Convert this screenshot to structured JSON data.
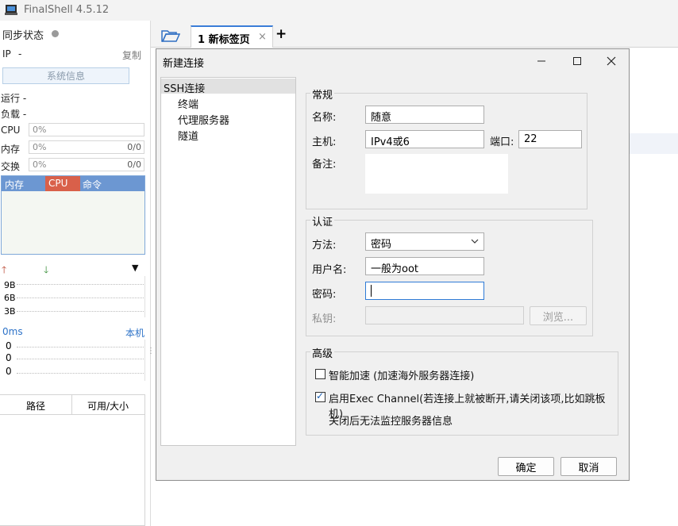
{
  "app": {
    "title": "FinalShell 4.5.12"
  },
  "left_panel": {
    "sync_label": "同步状态",
    "ip_label": "IP",
    "ip_value": "-",
    "copy_label": "复制",
    "sysinfo_button": "系统信息",
    "uptime_label": "运行 -",
    "load_label": "负载 -",
    "cpu": {
      "label": "CPU",
      "value": "0%"
    },
    "mem": {
      "label": "内存",
      "value": "0%",
      "right": "0/0"
    },
    "swap": {
      "label": "交换",
      "value": "0%",
      "right": "0/0"
    },
    "proc_headers": [
      "内存",
      "CPU",
      "命令"
    ],
    "net_ticks": [
      "9B",
      "6B",
      "3B"
    ],
    "ping": {
      "label": "0ms",
      "target": "本机",
      "ticks": [
        "0",
        "0",
        "0"
      ]
    },
    "disk_headers": [
      "路径",
      "可用/大小"
    ]
  },
  "tabs": [
    {
      "label": "1 新标签页"
    }
  ],
  "dialog": {
    "title": "新建连接",
    "nav": [
      "SSH连接",
      "终端",
      "代理服务器",
      "隧道"
    ],
    "general": {
      "title": "常规",
      "name_label": "名称:",
      "name_value": "随意",
      "host_label": "主机:",
      "host_value": "IPv4或6",
      "port_label": "端口:",
      "port_value": "22",
      "note_label": "备注:"
    },
    "auth": {
      "title": "认证",
      "method_label": "方法:",
      "method_value": "密码",
      "user_label": "用户名:",
      "user_value": "一般为oot",
      "password_label": "密码:",
      "password_value": "",
      "key_label": "私钥:",
      "browse_button": "浏览..."
    },
    "advanced": {
      "title": "高级",
      "smart_accel": "智能加速 (加速海外服务器连接)",
      "exec_channel": "启用Exec Channel(若连接上就被断开,请关闭该项,比如跳板机)",
      "exec_note": "关闭后无法监控服务器信息"
    },
    "ok_button": "确定",
    "cancel_button": "取消"
  },
  "colors": {
    "accent": "#3b7dd8",
    "proc_header": "#6c97d2",
    "cpu_header": "#d9604a"
  }
}
